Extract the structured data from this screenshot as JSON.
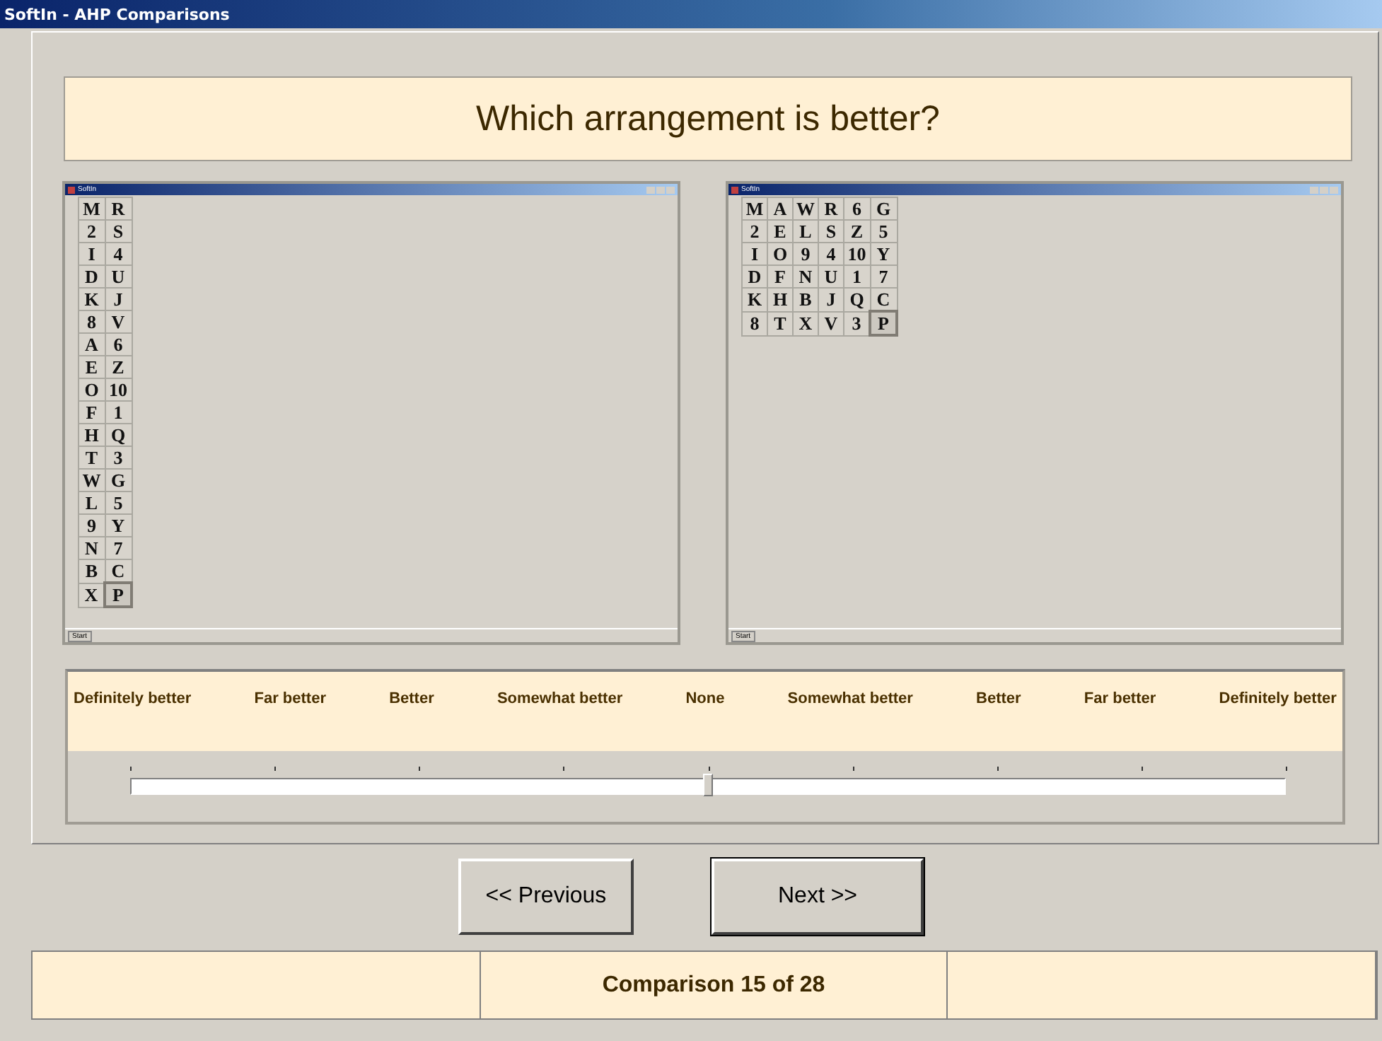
{
  "window": {
    "title": "SoftIn - AHP Comparisons"
  },
  "question": "Which arrangement is better?",
  "arrangements": [
    {
      "title": "SoftIn",
      "start": "Start",
      "cells": [
        [
          {
            "label": "M",
            "selected": false
          },
          {
            "label": "R",
            "selected": false
          }
        ],
        [
          {
            "label": "2",
            "selected": false
          },
          {
            "label": "S",
            "selected": false
          }
        ],
        [
          {
            "label": "I",
            "selected": false
          },
          {
            "label": "4",
            "selected": false
          }
        ],
        [
          {
            "label": "D",
            "selected": false
          },
          {
            "label": "U",
            "selected": false
          }
        ],
        [
          {
            "label": "K",
            "selected": false
          },
          {
            "label": "J",
            "selected": false
          }
        ],
        [
          {
            "label": "8",
            "selected": false
          },
          {
            "label": "V",
            "selected": false
          }
        ],
        [
          {
            "label": "A",
            "selected": false
          },
          {
            "label": "6",
            "selected": false
          }
        ],
        [
          {
            "label": "E",
            "selected": false
          },
          {
            "label": "Z",
            "selected": false
          }
        ],
        [
          {
            "label": "O",
            "selected": false
          },
          {
            "label": "10",
            "selected": false
          }
        ],
        [
          {
            "label": "F",
            "selected": false
          },
          {
            "label": "1",
            "selected": false
          }
        ],
        [
          {
            "label": "H",
            "selected": false
          },
          {
            "label": "Q",
            "selected": false
          }
        ],
        [
          {
            "label": "T",
            "selected": false
          },
          {
            "label": "3",
            "selected": false
          }
        ],
        [
          {
            "label": "W",
            "selected": false
          },
          {
            "label": "G",
            "selected": false
          }
        ],
        [
          {
            "label": "L",
            "selected": false
          },
          {
            "label": "5",
            "selected": false
          }
        ],
        [
          {
            "label": "9",
            "selected": false
          },
          {
            "label": "Y",
            "selected": false
          }
        ],
        [
          {
            "label": "N",
            "selected": false
          },
          {
            "label": "7",
            "selected": false
          }
        ],
        [
          {
            "label": "B",
            "selected": false
          },
          {
            "label": "C",
            "selected": false
          }
        ],
        [
          {
            "label": "X",
            "selected": false
          },
          {
            "label": "P",
            "selected": true
          }
        ]
      ]
    },
    {
      "title": "SoftIn",
      "start": "Start",
      "cells": [
        [
          {
            "label": "M",
            "selected": false
          },
          {
            "label": "A",
            "selected": false
          },
          {
            "label": "W",
            "selected": false
          },
          {
            "label": "R",
            "selected": false
          },
          {
            "label": "6",
            "selected": false
          },
          {
            "label": "G",
            "selected": false
          }
        ],
        [
          {
            "label": "2",
            "selected": false
          },
          {
            "label": "E",
            "selected": false
          },
          {
            "label": "L",
            "selected": false
          },
          {
            "label": "S",
            "selected": false
          },
          {
            "label": "Z",
            "selected": false
          },
          {
            "label": "5",
            "selected": false
          }
        ],
        [
          {
            "label": "I",
            "selected": false
          },
          {
            "label": "O",
            "selected": false
          },
          {
            "label": "9",
            "selected": false
          },
          {
            "label": "4",
            "selected": false
          },
          {
            "label": "10",
            "selected": false
          },
          {
            "label": "Y",
            "selected": false
          }
        ],
        [
          {
            "label": "D",
            "selected": false
          },
          {
            "label": "F",
            "selected": false
          },
          {
            "label": "N",
            "selected": false
          },
          {
            "label": "U",
            "selected": false
          },
          {
            "label": "1",
            "selected": false
          },
          {
            "label": "7",
            "selected": false
          }
        ],
        [
          {
            "label": "K",
            "selected": false
          },
          {
            "label": "H",
            "selected": false
          },
          {
            "label": "B",
            "selected": false
          },
          {
            "label": "J",
            "selected": false
          },
          {
            "label": "Q",
            "selected": false
          },
          {
            "label": "C",
            "selected": false
          }
        ],
        [
          {
            "label": "8",
            "selected": false
          },
          {
            "label": "T",
            "selected": false
          },
          {
            "label": "X",
            "selected": false
          },
          {
            "label": "V",
            "selected": false
          },
          {
            "label": "3",
            "selected": false
          },
          {
            "label": "P",
            "selected": true
          }
        ]
      ]
    }
  ],
  "scale": {
    "labels": [
      "Definitely better",
      "Far better",
      "Better",
      "Somewhat better",
      "None",
      "Somewhat better",
      "Better",
      "Far better",
      "Definitely better"
    ],
    "level": 0.5
  },
  "buttons": [
    "<< Previous",
    "Next >>"
  ],
  "status_bar": [
    "Comparison 15 of 28"
  ]
}
